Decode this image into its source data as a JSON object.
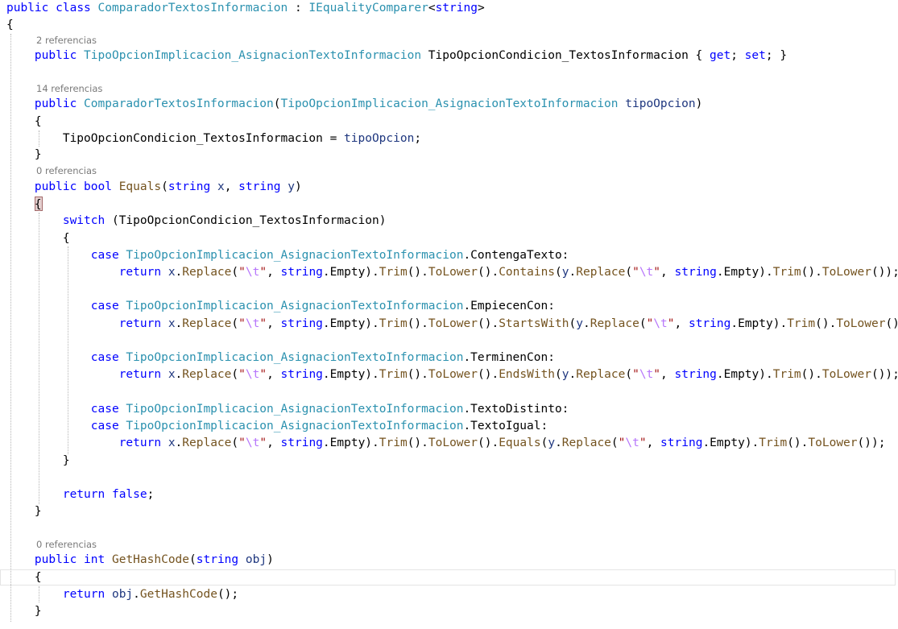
{
  "colors": {
    "keyword": "#0000ff",
    "type": "#2b91af",
    "string": "#a31515",
    "escape": "#b776fb",
    "method": "#74531f",
    "parameter": "#1f377f",
    "plain": "#000000",
    "codelens": "#7a7a7a",
    "background": "#ffffff"
  },
  "codelens": [
    "2 referencias",
    "14 referencias",
    "0 referencias",
    "0 referencias"
  ],
  "code_lines": [
    [
      [
        "kw",
        "public"
      ],
      [
        "plain",
        " "
      ],
      [
        "kw",
        "class"
      ],
      [
        "plain",
        " "
      ],
      [
        "type",
        "ComparadorTextosInformacion"
      ],
      [
        "plain",
        " : "
      ],
      [
        "type",
        "IEqualityComparer"
      ],
      [
        "plain",
        "<"
      ],
      [
        "kw",
        "string"
      ],
      [
        "plain",
        ">"
      ]
    ],
    [
      [
        "plain",
        "{"
      ]
    ],
    [
      [
        "plain",
        "    "
      ],
      [
        "kw",
        "public"
      ],
      [
        "plain",
        " "
      ],
      [
        "type",
        "TipoOpcionImplicacion_AsignacionTextoInformacion"
      ],
      [
        "plain",
        " TipoOpcionCondicion_TextosInformacion { "
      ],
      [
        "kw",
        "get"
      ],
      [
        "plain",
        "; "
      ],
      [
        "kw",
        "set"
      ],
      [
        "plain",
        "; }"
      ]
    ],
    [
      [
        "plain",
        "    "
      ],
      [
        "kw",
        "public"
      ],
      [
        "plain",
        " "
      ],
      [
        "type",
        "ComparadorTextosInformacion"
      ],
      [
        "plain",
        "("
      ],
      [
        "type",
        "TipoOpcionImplicacion_AsignacionTextoInformacion"
      ],
      [
        "plain",
        " "
      ],
      [
        "param",
        "tipoOpcion"
      ],
      [
        "plain",
        ")"
      ]
    ],
    [
      [
        "plain",
        "    {"
      ]
    ],
    [
      [
        "plain",
        "        TipoOpcionCondicion_TextosInformacion = "
      ],
      [
        "param",
        "tipoOpcion"
      ],
      [
        "plain",
        ";"
      ]
    ],
    [
      [
        "plain",
        "    }"
      ]
    ],
    [
      [
        "plain",
        "    "
      ],
      [
        "kw",
        "public"
      ],
      [
        "plain",
        " "
      ],
      [
        "kw",
        "bool"
      ],
      [
        "plain",
        " "
      ],
      [
        "meth",
        "Equals"
      ],
      [
        "plain",
        "("
      ],
      [
        "kw",
        "string"
      ],
      [
        "plain",
        " "
      ],
      [
        "param",
        "x"
      ],
      [
        "plain",
        ", "
      ],
      [
        "kw",
        "string"
      ],
      [
        "plain",
        " "
      ],
      [
        "param",
        "y"
      ],
      [
        "plain",
        ")"
      ]
    ],
    [
      [
        "plain",
        "    {"
      ]
    ],
    [
      [
        "plain",
        "        "
      ],
      [
        "kw",
        "switch"
      ],
      [
        "plain",
        " (TipoOpcionCondicion_TextosInformacion)"
      ]
    ],
    [
      [
        "plain",
        "        {"
      ]
    ],
    [
      [
        "plain",
        "            "
      ],
      [
        "kw",
        "case"
      ],
      [
        "plain",
        " "
      ],
      [
        "type",
        "TipoOpcionImplicacion_AsignacionTextoInformacion"
      ],
      [
        "plain",
        ".ContengaTexto:"
      ]
    ],
    [
      [
        "plain",
        "                "
      ],
      [
        "kw",
        "return"
      ],
      [
        "plain",
        " "
      ],
      [
        "param",
        "x"
      ],
      [
        "plain",
        "."
      ],
      [
        "meth",
        "Replace"
      ],
      [
        "plain",
        "("
      ],
      [
        "str",
        "\""
      ],
      [
        "esc",
        "\\t"
      ],
      [
        "str",
        "\""
      ],
      [
        "plain",
        ", "
      ],
      [
        "kw",
        "string"
      ],
      [
        "plain",
        ".Empty)."
      ],
      [
        "meth",
        "Trim"
      ],
      [
        "plain",
        "()."
      ],
      [
        "meth",
        "ToLower"
      ],
      [
        "plain",
        "()."
      ],
      [
        "meth",
        "Contains"
      ],
      [
        "plain",
        "("
      ],
      [
        "param",
        "y"
      ],
      [
        "plain",
        "."
      ],
      [
        "meth",
        "Replace"
      ],
      [
        "plain",
        "("
      ],
      [
        "str",
        "\""
      ],
      [
        "esc",
        "\\t"
      ],
      [
        "str",
        "\""
      ],
      [
        "plain",
        ", "
      ],
      [
        "kw",
        "string"
      ],
      [
        "plain",
        ".Empty)."
      ],
      [
        "meth",
        "Trim"
      ],
      [
        "plain",
        "()."
      ],
      [
        "meth",
        "ToLower"
      ],
      [
        "plain",
        "());"
      ]
    ],
    [
      [
        "plain",
        "            "
      ],
      [
        "kw",
        "case"
      ],
      [
        "plain",
        " "
      ],
      [
        "type",
        "TipoOpcionImplicacion_AsignacionTextoInformacion"
      ],
      [
        "plain",
        ".EmpiecenCon:"
      ]
    ],
    [
      [
        "plain",
        "                "
      ],
      [
        "kw",
        "return"
      ],
      [
        "plain",
        " "
      ],
      [
        "param",
        "x"
      ],
      [
        "plain",
        "."
      ],
      [
        "meth",
        "Replace"
      ],
      [
        "plain",
        "("
      ],
      [
        "str",
        "\""
      ],
      [
        "esc",
        "\\t"
      ],
      [
        "str",
        "\""
      ],
      [
        "plain",
        ", "
      ],
      [
        "kw",
        "string"
      ],
      [
        "plain",
        ".Empty)."
      ],
      [
        "meth",
        "Trim"
      ],
      [
        "plain",
        "()."
      ],
      [
        "meth",
        "ToLower"
      ],
      [
        "plain",
        "()."
      ],
      [
        "meth",
        "StartsWith"
      ],
      [
        "plain",
        "("
      ],
      [
        "param",
        "y"
      ],
      [
        "plain",
        "."
      ],
      [
        "meth",
        "Replace"
      ],
      [
        "plain",
        "("
      ],
      [
        "str",
        "\""
      ],
      [
        "esc",
        "\\t"
      ],
      [
        "str",
        "\""
      ],
      [
        "plain",
        ", "
      ],
      [
        "kw",
        "string"
      ],
      [
        "plain",
        ".Empty)."
      ],
      [
        "meth",
        "Trim"
      ],
      [
        "plain",
        "()."
      ],
      [
        "meth",
        "ToLower"
      ],
      [
        "plain",
        "());"
      ]
    ],
    [
      [
        "plain",
        "            "
      ],
      [
        "kw",
        "case"
      ],
      [
        "plain",
        " "
      ],
      [
        "type",
        "TipoOpcionImplicacion_AsignacionTextoInformacion"
      ],
      [
        "plain",
        ".TerminenCon:"
      ]
    ],
    [
      [
        "plain",
        "                "
      ],
      [
        "kw",
        "return"
      ],
      [
        "plain",
        " "
      ],
      [
        "param",
        "x"
      ],
      [
        "plain",
        "."
      ],
      [
        "meth",
        "Replace"
      ],
      [
        "plain",
        "("
      ],
      [
        "str",
        "\""
      ],
      [
        "esc",
        "\\t"
      ],
      [
        "str",
        "\""
      ],
      [
        "plain",
        ", "
      ],
      [
        "kw",
        "string"
      ],
      [
        "plain",
        ".Empty)."
      ],
      [
        "meth",
        "Trim"
      ],
      [
        "plain",
        "()."
      ],
      [
        "meth",
        "ToLower"
      ],
      [
        "plain",
        "()."
      ],
      [
        "meth",
        "EndsWith"
      ],
      [
        "plain",
        "("
      ],
      [
        "param",
        "y"
      ],
      [
        "plain",
        "."
      ],
      [
        "meth",
        "Replace"
      ],
      [
        "plain",
        "("
      ],
      [
        "str",
        "\""
      ],
      [
        "esc",
        "\\t"
      ],
      [
        "str",
        "\""
      ],
      [
        "plain",
        ", "
      ],
      [
        "kw",
        "string"
      ],
      [
        "plain",
        ".Empty)."
      ],
      [
        "meth",
        "Trim"
      ],
      [
        "plain",
        "()."
      ],
      [
        "meth",
        "ToLower"
      ],
      [
        "plain",
        "());"
      ]
    ],
    [
      [
        "plain",
        "            "
      ],
      [
        "kw",
        "case"
      ],
      [
        "plain",
        " "
      ],
      [
        "type",
        "TipoOpcionImplicacion_AsignacionTextoInformacion"
      ],
      [
        "plain",
        ".TextoDistinto:"
      ]
    ],
    [
      [
        "plain",
        "            "
      ],
      [
        "kw",
        "case"
      ],
      [
        "plain",
        " "
      ],
      [
        "type",
        "TipoOpcionImplicacion_AsignacionTextoInformacion"
      ],
      [
        "plain",
        ".TextoIgual:"
      ]
    ],
    [
      [
        "plain",
        "                "
      ],
      [
        "kw",
        "return"
      ],
      [
        "plain",
        " "
      ],
      [
        "param",
        "x"
      ],
      [
        "plain",
        "."
      ],
      [
        "meth",
        "Replace"
      ],
      [
        "plain",
        "("
      ],
      [
        "str",
        "\""
      ],
      [
        "esc",
        "\\t"
      ],
      [
        "str",
        "\""
      ],
      [
        "plain",
        ", "
      ],
      [
        "kw",
        "string"
      ],
      [
        "plain",
        ".Empty)."
      ],
      [
        "meth",
        "Trim"
      ],
      [
        "plain",
        "()."
      ],
      [
        "meth",
        "ToLower"
      ],
      [
        "plain",
        "()."
      ],
      [
        "meth",
        "Equals"
      ],
      [
        "plain",
        "("
      ],
      [
        "param",
        "y"
      ],
      [
        "plain",
        "."
      ],
      [
        "meth",
        "Replace"
      ],
      [
        "plain",
        "("
      ],
      [
        "str",
        "\""
      ],
      [
        "esc",
        "\\t"
      ],
      [
        "str",
        "\""
      ],
      [
        "plain",
        ", "
      ],
      [
        "kw",
        "string"
      ],
      [
        "plain",
        ".Empty)."
      ],
      [
        "meth",
        "Trim"
      ],
      [
        "plain",
        "()."
      ],
      [
        "meth",
        "ToLower"
      ],
      [
        "plain",
        "());"
      ]
    ],
    [
      [
        "plain",
        "        }"
      ]
    ],
    [
      [
        "plain",
        "        "
      ],
      [
        "kw",
        "return"
      ],
      [
        "plain",
        " "
      ],
      [
        "kw",
        "false"
      ],
      [
        "plain",
        ";"
      ]
    ],
    [
      [
        "plain",
        "    }"
      ]
    ],
    [
      [
        "plain",
        "    "
      ],
      [
        "kw",
        "public"
      ],
      [
        "plain",
        " "
      ],
      [
        "kw",
        "int"
      ],
      [
        "plain",
        " "
      ],
      [
        "meth",
        "GetHashCode"
      ],
      [
        "plain",
        "("
      ],
      [
        "kw",
        "string"
      ],
      [
        "plain",
        " "
      ],
      [
        "param",
        "obj"
      ],
      [
        "plain",
        ")"
      ]
    ],
    [
      [
        "plain",
        "    {"
      ]
    ],
    [
      [
        "plain",
        "        "
      ],
      [
        "kw",
        "return"
      ],
      [
        "plain",
        " "
      ],
      [
        "param",
        "obj"
      ],
      [
        "plain",
        "."
      ],
      [
        "meth",
        "GetHashCode"
      ],
      [
        "plain",
        "();"
      ]
    ],
    [
      [
        "plain",
        "    }"
      ]
    ]
  ]
}
